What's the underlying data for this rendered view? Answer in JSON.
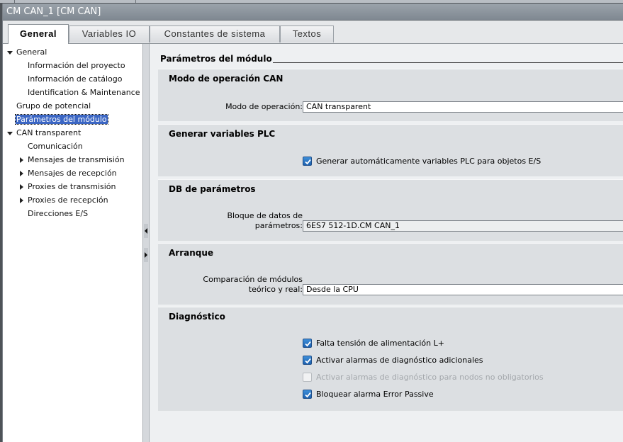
{
  "window": {
    "title": "CM CAN_1 [CM CAN]"
  },
  "tabs": [
    {
      "label": "General",
      "active": true
    },
    {
      "label": "Variables IO",
      "active": false
    },
    {
      "label": "Constantes de sistema",
      "active": false
    },
    {
      "label": "Textos",
      "active": false
    }
  ],
  "nav": {
    "items": [
      {
        "label": "General",
        "expanded": true
      },
      {
        "label": "Información del proyecto"
      },
      {
        "label": "Información de catálogo"
      },
      {
        "label": "Identification & Maintenance"
      },
      {
        "label": "Grupo de potencial"
      },
      {
        "label": "Parámetros del módulo",
        "selected": true
      },
      {
        "label": "CAN transparent",
        "expanded": true
      },
      {
        "label": "Comunicación"
      },
      {
        "label": "Mensajes de transmisión",
        "collapsed": true
      },
      {
        "label": "Mensajes de recepción",
        "collapsed": true
      },
      {
        "label": "Proxies de transmisión",
        "collapsed": true
      },
      {
        "label": "Proxies de recepción",
        "collapsed": true
      },
      {
        "label": "Direcciones E/S"
      }
    ]
  },
  "content": {
    "title": "Parámetros del módulo",
    "sections": {
      "can_mode": {
        "title": "Modo de operación CAN",
        "field_label": "Modo de operación:",
        "field_value": "CAN transparent"
      },
      "plc_vars": {
        "title": "Generar variables PLC",
        "checkbox_label": "Generar automáticamente variables PLC para objetos E/S",
        "checked": true
      },
      "param_db": {
        "title": "DB de parámetros",
        "field_label_line1": "Bloque de datos de",
        "field_label_line2": "parámetros:",
        "field_value": "6ES7 512-1D.CM CAN_1"
      },
      "startup": {
        "title": "Arranque",
        "field_label_line1": "Comparación de módulos",
        "field_label_line2": "teórico y real:",
        "field_value": "Desde la CPU"
      },
      "diagnostics": {
        "title": "Diagnóstico",
        "options": [
          {
            "label": "Falta tensión de alimentación L+",
            "checked": true,
            "enabled": true
          },
          {
            "label": "Activar alarmas de diagnóstico adicionales",
            "checked": true,
            "enabled": true
          },
          {
            "label": "Activar alarmas de diagnóstico para nodos no obligatorios",
            "checked": false,
            "enabled": false
          },
          {
            "label": "Bloquear alarma Error Passive",
            "checked": true,
            "enabled": true
          }
        ]
      }
    }
  },
  "colors": {
    "selection": "#3b66c4",
    "checkbox": "#1d62b0",
    "title_bar": "#8a939b"
  }
}
